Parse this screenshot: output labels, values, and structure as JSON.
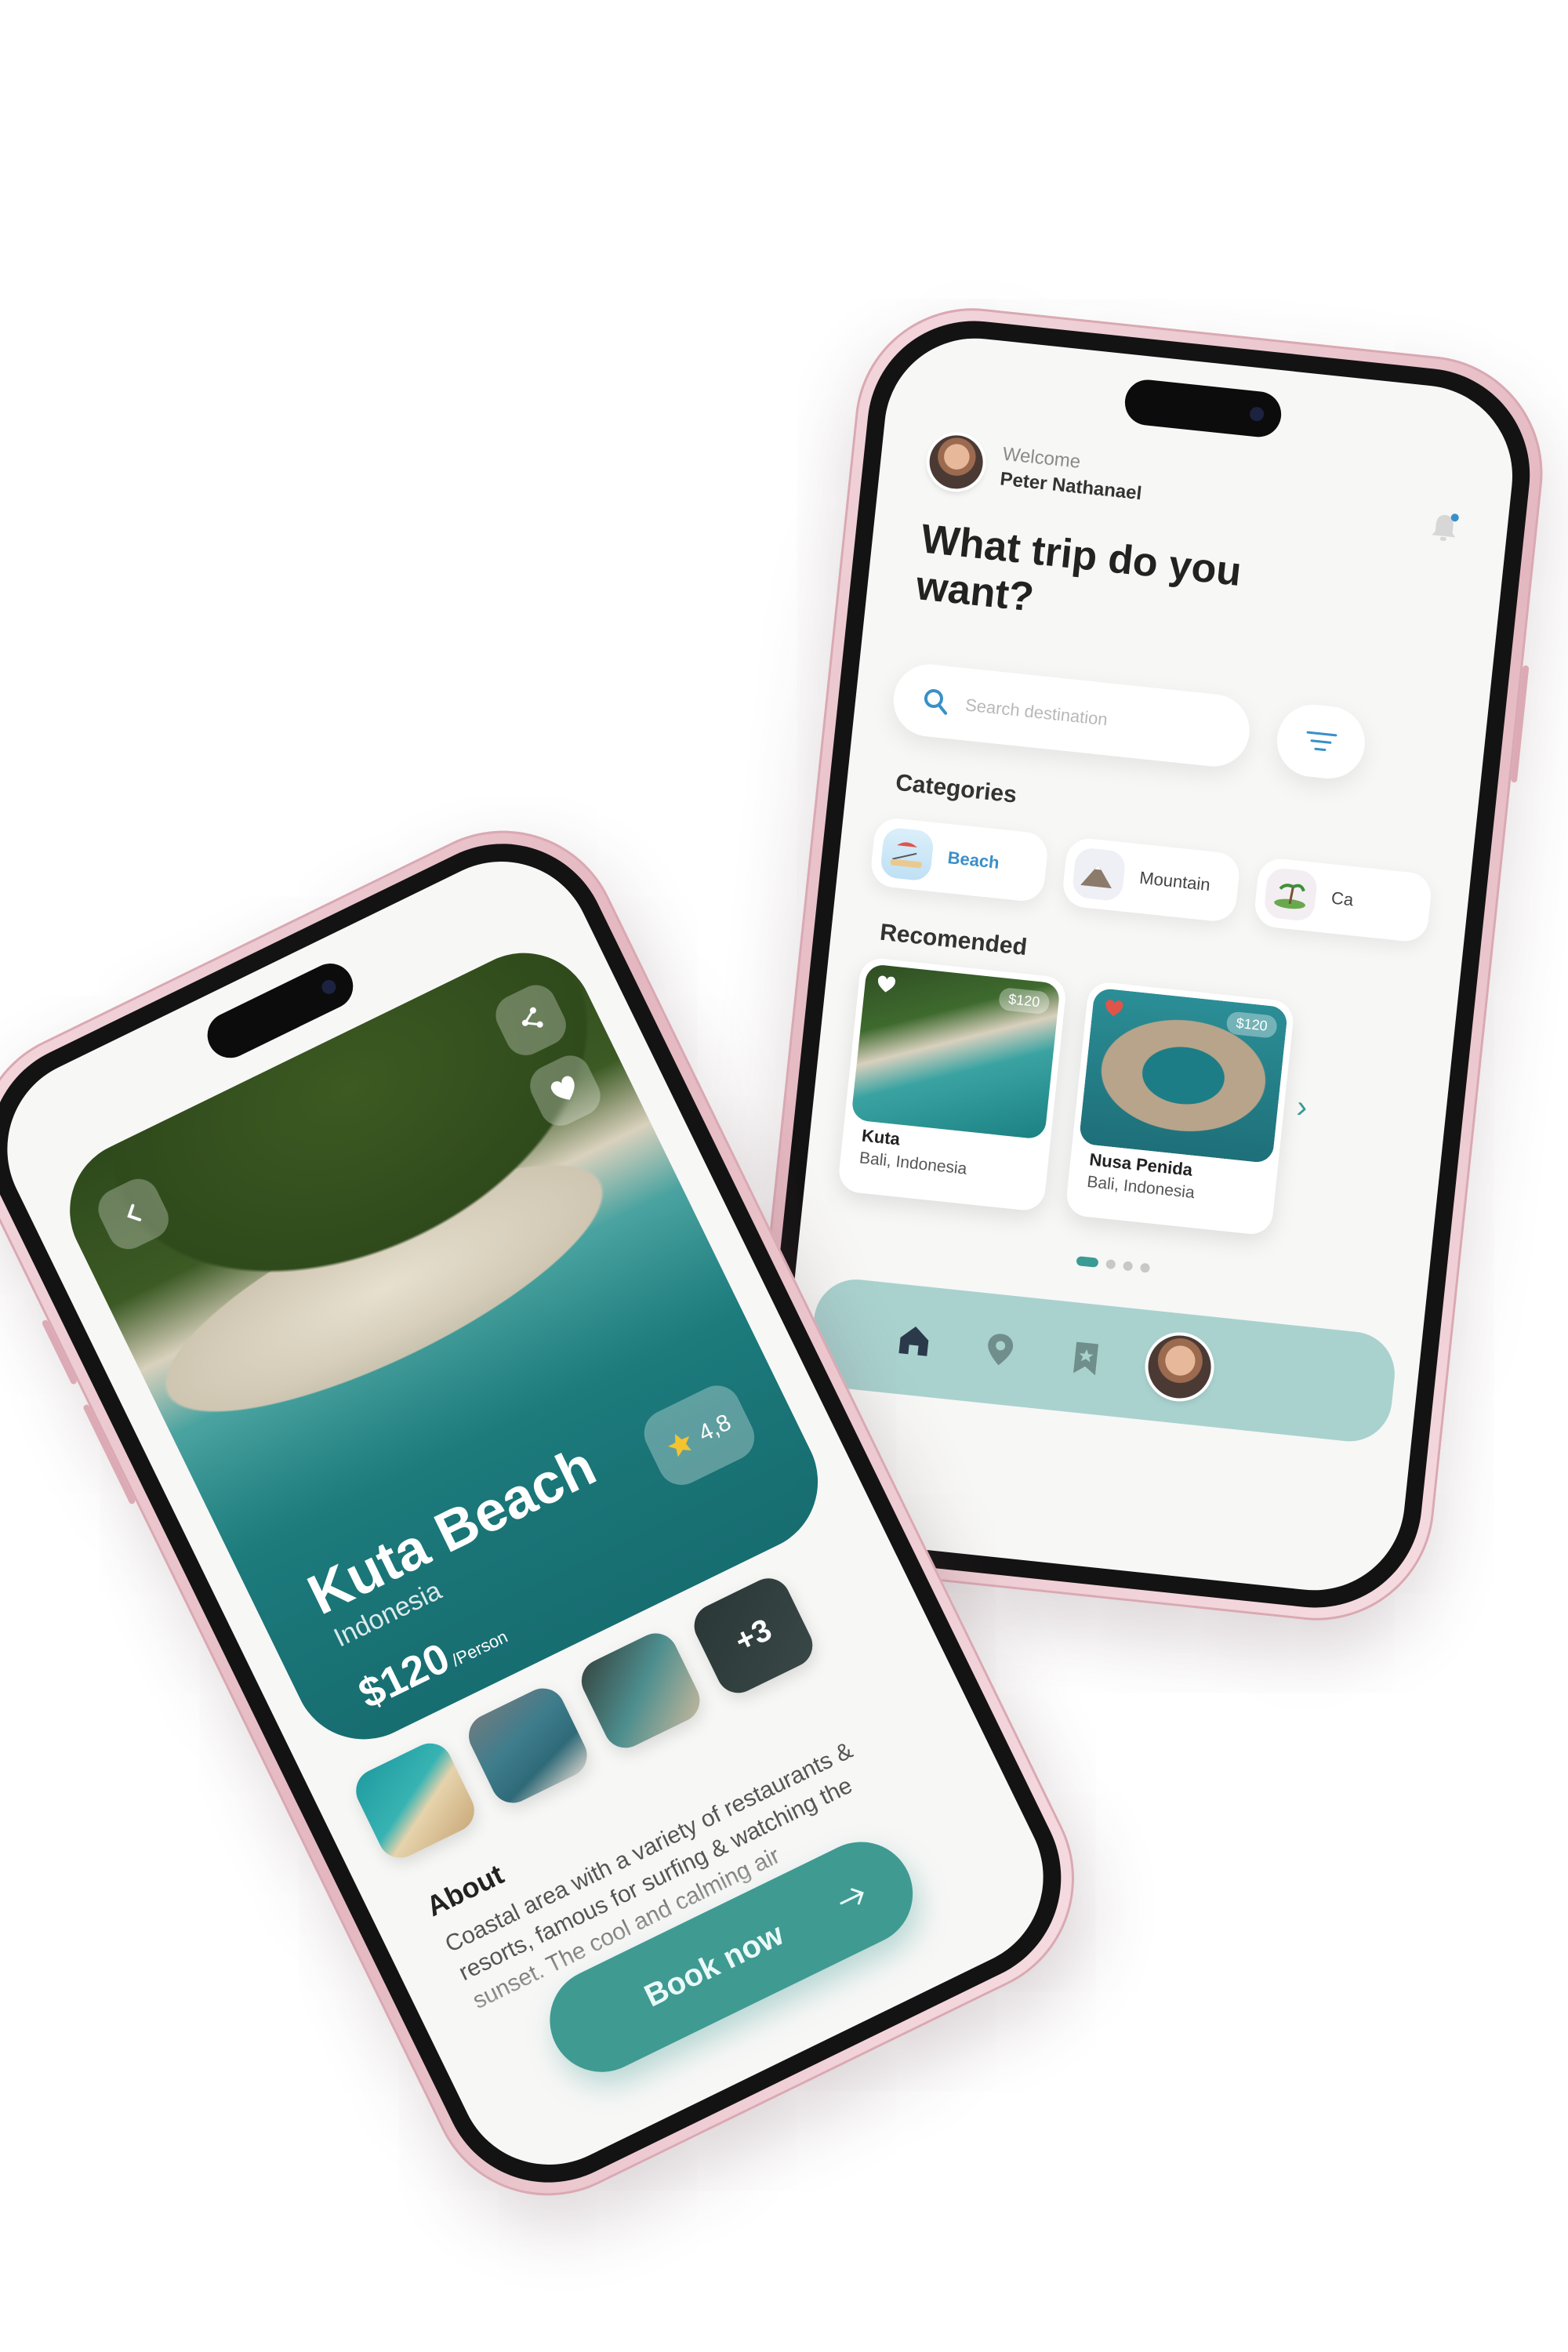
{
  "home": {
    "welcome": "Welcome",
    "user_name": "Peter Nathanael",
    "headline": "What trip do you want?",
    "search_placeholder": "Search destination",
    "categories_title": "Categories",
    "categories": [
      {
        "label": "Beach",
        "active": true
      },
      {
        "label": "Mountain",
        "active": false
      },
      {
        "label": "Ca",
        "active": false
      }
    ],
    "recommended_title": "Recomended",
    "recommended": [
      {
        "name": "Kuta",
        "location": "Bali, Indonesia",
        "price": "$120"
      },
      {
        "name": "Nusa Penida",
        "location": "Bali, Indonesia",
        "price": "$120"
      }
    ],
    "nav": [
      "home-icon",
      "location-pin-icon",
      "bookmark-icon",
      "profile-avatar"
    ]
  },
  "detail": {
    "title": "Kuta Beach",
    "country": "Indonesia",
    "price": "$120",
    "price_unit": "/Person",
    "rating": "4,8",
    "more_photos": "+3",
    "about_title": "About",
    "about_text": "Coastal area with a variety of restaurants & resorts, famous for surfing & watching the sunset. The cool and calming air",
    "book_label": "Book now"
  },
  "colors": {
    "accent_teal": "#3f9a92",
    "nav_bg": "#a9d2cf",
    "category_active": "#3a8fc9",
    "phone_frame": "#e4b7c0"
  }
}
